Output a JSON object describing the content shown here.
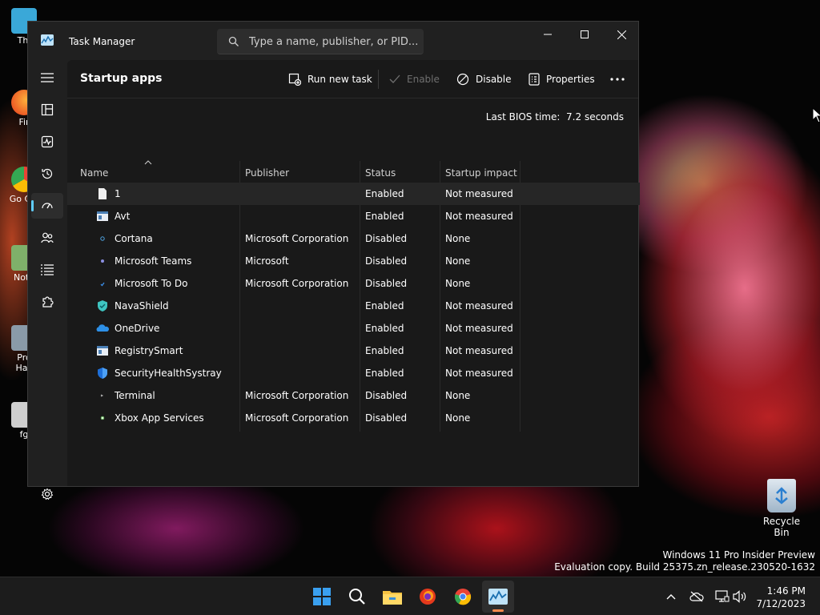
{
  "window": {
    "title": "Task Manager",
    "search_placeholder": "Type a name, publisher, or PID..."
  },
  "sidebar": {
    "items": [
      {
        "name": "hamburger-menu"
      },
      {
        "name": "processes"
      },
      {
        "name": "performance"
      },
      {
        "name": "app-history"
      },
      {
        "name": "startup-apps",
        "active": true
      },
      {
        "name": "users"
      },
      {
        "name": "details"
      },
      {
        "name": "services"
      },
      {
        "name": "settings"
      }
    ]
  },
  "toolbar": {
    "page_title": "Startup apps",
    "run_new_task": "Run new task",
    "enable": "Enable",
    "disable": "Disable",
    "properties": "Properties"
  },
  "bios": {
    "label": "Last BIOS time:",
    "value": "7.2 seconds"
  },
  "table": {
    "columns": [
      "Name",
      "Publisher",
      "Status",
      "Startup impact"
    ],
    "rows": [
      {
        "name": "1",
        "publisher": "",
        "status": "Enabled",
        "impact": "Not measured",
        "icon": "file-icon"
      },
      {
        "name": "Avt",
        "publisher": "",
        "status": "Enabled",
        "impact": "Not measured",
        "icon": "app-window-icon"
      },
      {
        "name": "Cortana",
        "publisher": "Microsoft Corporation",
        "status": "Disabled",
        "impact": "None",
        "icon": "cortana-icon"
      },
      {
        "name": "Microsoft Teams",
        "publisher": "Microsoft",
        "status": "Disabled",
        "impact": "None",
        "icon": "teams-icon"
      },
      {
        "name": "Microsoft To Do",
        "publisher": "Microsoft Corporation",
        "status": "Disabled",
        "impact": "None",
        "icon": "todo-icon"
      },
      {
        "name": "NavaShield",
        "publisher": "",
        "status": "Enabled",
        "impact": "Not measured",
        "icon": "navashield-icon"
      },
      {
        "name": "OneDrive",
        "publisher": "",
        "status": "Enabled",
        "impact": "Not measured",
        "icon": "onedrive-icon"
      },
      {
        "name": "RegistrySmart",
        "publisher": "",
        "status": "Enabled",
        "impact": "Not measured",
        "icon": "app-window-icon"
      },
      {
        "name": "SecurityHealthSystray",
        "publisher": "",
        "status": "Enabled",
        "impact": "Not measured",
        "icon": "shield-icon"
      },
      {
        "name": "Terminal",
        "publisher": "Microsoft Corporation",
        "status": "Disabled",
        "impact": "None",
        "icon": "terminal-icon"
      },
      {
        "name": "Xbox App Services",
        "publisher": "Microsoft Corporation",
        "status": "Disabled",
        "impact": "None",
        "icon": "xbox-icon"
      }
    ]
  },
  "desktop": {
    "icons": [
      "Thi",
      "Fir",
      "Go Chi",
      "Note",
      "Pro Hac",
      "fg"
    ],
    "recycle_bin": "Recycle Bin",
    "watermark_line1": "Windows 11 Pro Insider Preview",
    "watermark_line2": "Evaluation copy. Build 25375.zn_release.230520-1632"
  },
  "taskbar": {
    "time": "1:46 PM",
    "date": "7/12/2023"
  },
  "colors": {
    "accent": "#60cdff",
    "window_bg": "#202020",
    "content_bg": "#191919"
  }
}
